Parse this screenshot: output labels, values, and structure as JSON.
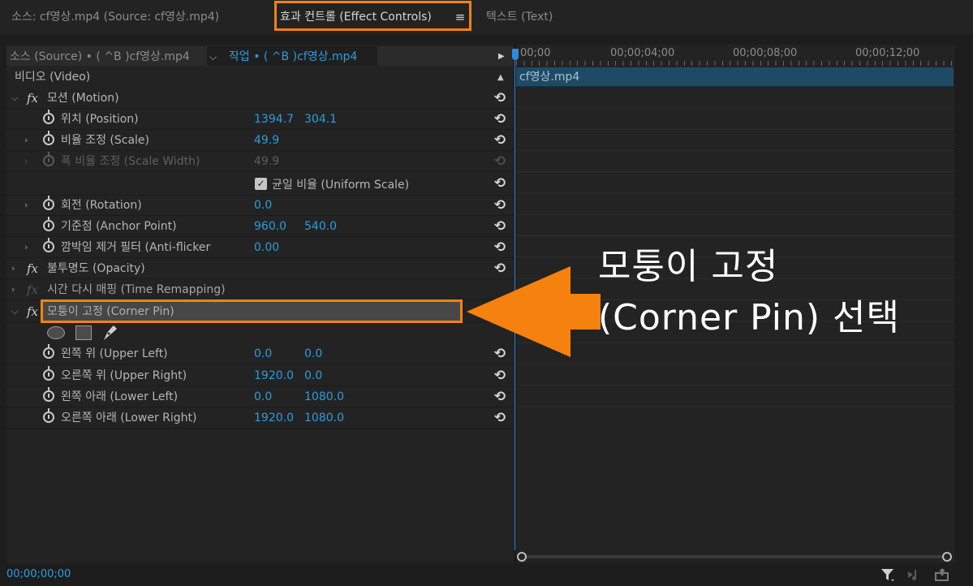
{
  "tabs": [
    {
      "label": "소스: cf영상.mp4 (Source: cf영상.mp4)",
      "active": false
    },
    {
      "label": "효과 컨트롤 (Effect Controls)",
      "active": true
    },
    {
      "label": "텍스트 (Text)",
      "active": false
    }
  ],
  "tab_menu_icon": "≡",
  "clip_header": {
    "source": "소스 (Source) • ( ^B )cf영상.mp4",
    "sequence": "작업 • ( ^B )cf영상.mp4"
  },
  "video_section": "비디오 (Video)",
  "effects": {
    "motion": {
      "name": "모션 (Motion)",
      "position": {
        "label": "위치 (Position)",
        "x": "1394.7",
        "y": "304.1"
      },
      "scale": {
        "label": "비율 조정 (Scale)",
        "value": "49.9"
      },
      "scale_width": {
        "label": "폭 비율 조정 (Scale Width)",
        "value": "49.9"
      },
      "uniform_scale": {
        "label": "균일 비율 (Uniform Scale)",
        "checked": true
      },
      "rotation": {
        "label": "회전 (Rotation)",
        "value": "0.0"
      },
      "anchor_point": {
        "label": "기준점 (Anchor Point)",
        "x": "960.0",
        "y": "540.0"
      },
      "anti_flicker": {
        "label": "깜박임 제거 필터 (Anti-flicker",
        "value": "0.00"
      }
    },
    "opacity": {
      "name": "불투명도 (Opacity)"
    },
    "time_remapping": {
      "name": "시간 다시 매핑 (Time Remapping)"
    },
    "corner_pin": {
      "name": "모퉁이 고정 (Corner Pin)",
      "upper_left": {
        "label": "왼쪽 위 (Upper Left)",
        "x": "0.0",
        "y": "0.0"
      },
      "upper_right": {
        "label": "오른쪽 위 (Upper Right)",
        "x": "1920.0",
        "y": "0.0"
      },
      "lower_left": {
        "label": "왼쪽 아래 (Lower Left)",
        "x": "0.0",
        "y": "1080.0"
      },
      "lower_right": {
        "label": "오른쪽 아래 (Lower Right)",
        "x": "1920.0",
        "y": "1080.0"
      }
    }
  },
  "mask_tools": [
    "ellipse-mask-icon",
    "rectangle-mask-icon",
    "pen-mask-icon"
  ],
  "timeline": {
    "ruler": [
      "00;00",
      "00;00;04;00",
      "00;00;08;00",
      "00;00;12;00"
    ],
    "clip_label": "cf영상.mp4"
  },
  "footer": {
    "timecode": "00;00;00;00",
    "icons": [
      "filter-icon",
      "audio-icon",
      "export-icon"
    ]
  },
  "annotation": {
    "line1": "모퉁이 고정",
    "line2": "(Corner Pin) 선택",
    "color": "#f5820f"
  },
  "colors": {
    "accent_blue": "#2d9cdb",
    "highlight_orange": "#f5820f",
    "panel_bg": "#232323"
  }
}
